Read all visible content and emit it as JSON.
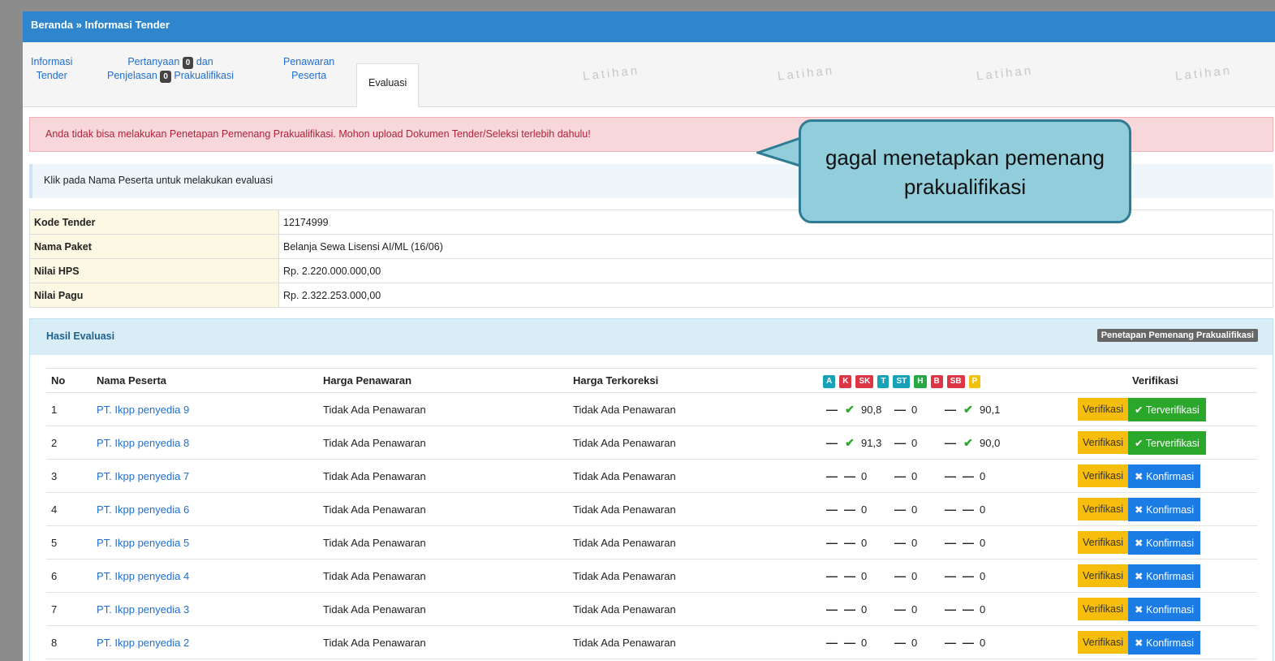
{
  "breadcrumb": "Beranda » Informasi Tender",
  "tabs": {
    "t1_line1": "Informasi",
    "t1_line2": "Tender",
    "t2_a": "Pertanyaan",
    "t2_b": "dan",
    "t2_c": "Penjelasan",
    "t2_d": "Prakualifikasi",
    "t2_count1": "0",
    "t2_count2": "0",
    "t3_line1": "Penawaran",
    "t3_line2": "Peserta",
    "t4": "Evaluasi"
  },
  "watermark": "Latihan",
  "alert_text": "Anda tidak bisa melakukan Penetapan Pemenang Prakualifikasi. Mohon upload Dokumen Tender/Seleksi terlebih dahulu!",
  "info_text": "Klik pada Nama Peserta untuk melakukan evaluasi",
  "callout_text": "gagal menetapkan pemenang prakualifikasi",
  "detail": [
    {
      "label": "Kode Tender",
      "value": "12174999"
    },
    {
      "label": "Nama Paket",
      "value": "Belanja Sewa Lisensi AI/ML (16/06)"
    },
    {
      "label": "Nilai HPS",
      "value": "Rp. 2.220.000.000,00"
    },
    {
      "label": "Nilai Pagu",
      "value": "Rp. 2.322.253.000,00"
    }
  ],
  "panel": {
    "title": "Hasil Evaluasi",
    "button": "Penetapan Pemenang Prakualifikasi"
  },
  "columns": {
    "no": "No",
    "nama": "Nama Peserta",
    "harga": "Harga Penawaran",
    "terkoreksi": "Harga Terkoreksi",
    "verifikasi": "Verifikasi"
  },
  "eval_badges": [
    {
      "text": "A",
      "color": "#17a2b8"
    },
    {
      "text": "K",
      "color": "#dc3545"
    },
    {
      "text": "SK",
      "color": "#dc3545"
    },
    {
      "text": "T",
      "color": "#17a2b8"
    },
    {
      "text": "ST",
      "color": "#17a2b8"
    },
    {
      "text": "H",
      "color": "#28a745"
    },
    {
      "text": "B",
      "color": "#dc3545"
    },
    {
      "text": "SB",
      "color": "#dc3545"
    },
    {
      "text": "P",
      "color": "#f0c20a"
    }
  ],
  "rows": [
    {
      "no": "1",
      "nama": "PT. Ikpp penyedia 9",
      "harga": "Tidak Ada Penawaran",
      "terkoreksi": "Tidak Ada Penawaran",
      "s1": "90,8",
      "s2": "0",
      "s3": "90,1",
      "k": "check",
      "b": "check",
      "v": "Verifikasi",
      "status": "Terverifikasi",
      "ok": true
    },
    {
      "no": "2",
      "nama": "PT. Ikpp penyedia 8",
      "harga": "Tidak Ada Penawaran",
      "terkoreksi": "Tidak Ada Penawaran",
      "s1": "91,3",
      "s2": "0",
      "s3": "90,0",
      "k": "check",
      "b": "check",
      "v": "Verifikasi",
      "status": "Terverifikasi",
      "ok": true
    },
    {
      "no": "3",
      "nama": "PT. Ikpp penyedia 7",
      "harga": "Tidak Ada Penawaran",
      "terkoreksi": "Tidak Ada Penawaran",
      "s1": "0",
      "s2": "0",
      "s3": "0",
      "k": "dash",
      "b": "dash",
      "v": "Verifikasi",
      "status": "Konfirmasi",
      "ok": false
    },
    {
      "no": "4",
      "nama": "PT. Ikpp penyedia 6",
      "harga": "Tidak Ada Penawaran",
      "terkoreksi": "Tidak Ada Penawaran",
      "s1": "0",
      "s2": "0",
      "s3": "0",
      "k": "dash",
      "b": "dash",
      "v": "Verifikasi",
      "status": "Konfirmasi",
      "ok": false
    },
    {
      "no": "5",
      "nama": "PT. Ikpp penyedia 5",
      "harga": "Tidak Ada Penawaran",
      "terkoreksi": "Tidak Ada Penawaran",
      "s1": "0",
      "s2": "0",
      "s3": "0",
      "k": "dash",
      "b": "dash",
      "v": "Verifikasi",
      "status": "Konfirmasi",
      "ok": false
    },
    {
      "no": "6",
      "nama": "PT. Ikpp penyedia 4",
      "harga": "Tidak Ada Penawaran",
      "terkoreksi": "Tidak Ada Penawaran",
      "s1": "0",
      "s2": "0",
      "s3": "0",
      "k": "dash",
      "b": "dash",
      "v": "Verifikasi",
      "status": "Konfirmasi",
      "ok": false
    },
    {
      "no": "7",
      "nama": "PT. Ikpp penyedia 3",
      "harga": "Tidak Ada Penawaran",
      "terkoreksi": "Tidak Ada Penawaran",
      "s1": "0",
      "s2": "0",
      "s3": "0",
      "k": "dash",
      "b": "dash",
      "v": "Verifikasi",
      "status": "Konfirmasi",
      "ok": false
    },
    {
      "no": "8",
      "nama": "PT. Ikpp penyedia 2",
      "harga": "Tidak Ada Penawaran",
      "terkoreksi": "Tidak Ada Penawaran",
      "s1": "0",
      "s2": "0",
      "s3": "0",
      "k": "dash",
      "b": "dash",
      "v": "Verifikasi",
      "status": "Konfirmasi",
      "ok": false
    }
  ]
}
